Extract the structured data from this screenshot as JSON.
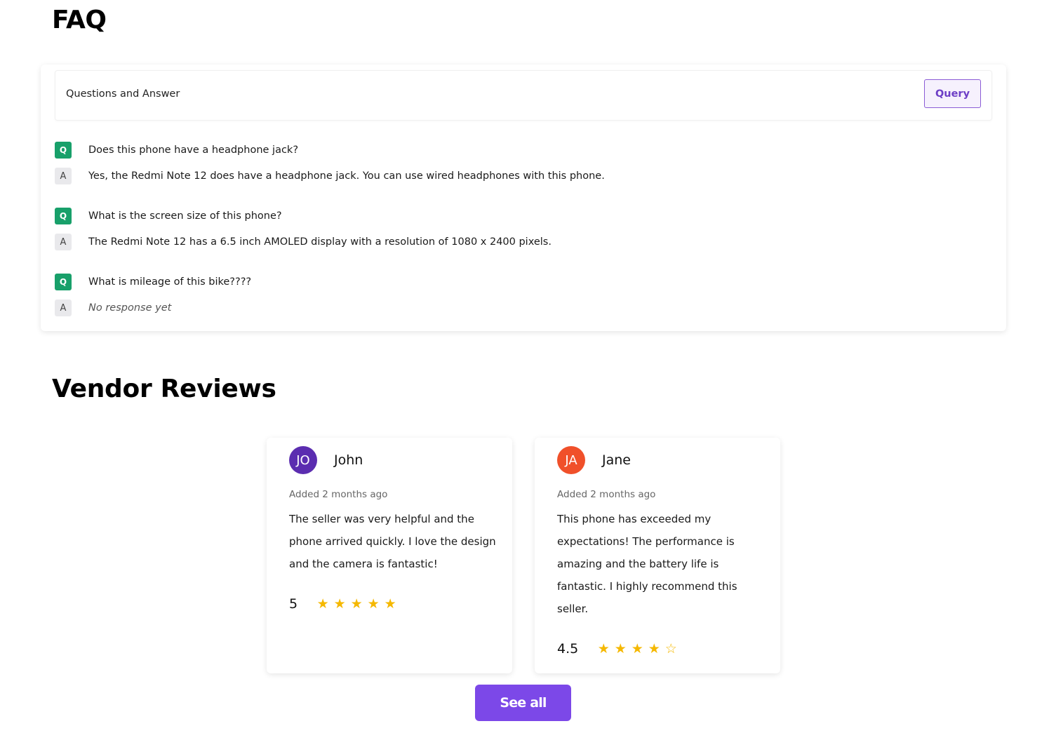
{
  "faq": {
    "title": "FAQ",
    "header_label": "Questions and Answer",
    "query_label": "Query",
    "q_badge": "Q",
    "a_badge": "A",
    "items": [
      {
        "question": "Does this phone have a headphone jack?",
        "answer": "Yes, the Redmi Note 12 does have a headphone jack. You can use wired headphones with this phone."
      },
      {
        "question": "What is the screen size of this phone?",
        "answer": "The Redmi Note 12 has a 6.5 inch AMOLED display with a resolution of 1080 x 2400 pixels."
      },
      {
        "question": "What is mileage of this bike????",
        "answer": "No response yet"
      }
    ]
  },
  "reviews": {
    "title": "Vendor Reviews",
    "items": [
      {
        "initials": "JO",
        "avatar_color": "#5b2db0",
        "name": "John",
        "date": "Added 2 months ago",
        "text": "The seller was very helpful and the phone arrived quickly. I love the design and the camera is fantastic!",
        "rating": "5",
        "stars": [
          "★",
          "★",
          "★",
          "★",
          "★"
        ]
      },
      {
        "initials": "JA",
        "avatar_color": "#f0502a",
        "name": "Jane",
        "date": "Added 2 months ago",
        "text": "This phone has exceeded my expectations! The performance is amazing and the battery life is fantastic. I highly recommend this seller.",
        "rating": "4.5",
        "stars": [
          "★",
          "★",
          "★",
          "★",
          "☆"
        ]
      }
    ],
    "see_all_label": "See all"
  },
  "colors": {
    "accent": "#7c48e8",
    "question_badge": "#18a06a",
    "star": "#f5b800"
  }
}
